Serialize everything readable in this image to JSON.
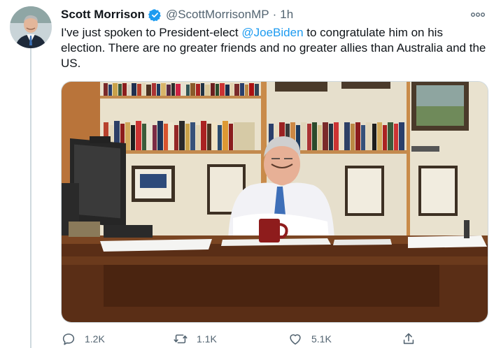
{
  "tweet": {
    "author_name": "Scott Morrison",
    "handle": "@ScottMorrisonMP",
    "separator": "·",
    "time": "1h",
    "text_before": "I've just spoken to President-elect ",
    "mention": "@JoeBiden",
    "text_after": " to congratulate him on his election. There are no greater friends and no greater allies than Australia and the US."
  },
  "actions": {
    "reply_count": "1.2K",
    "retweet_count": "1.1K",
    "like_count": "5.1K"
  },
  "icons": [
    "verified-badge-icon",
    "more-options-icon",
    "reply-icon",
    "retweet-icon",
    "like-icon",
    "share-icon"
  ],
  "colors": {
    "accent": "#1d9bf0",
    "secondary_text": "#536471",
    "divider": "#cfd9de"
  }
}
